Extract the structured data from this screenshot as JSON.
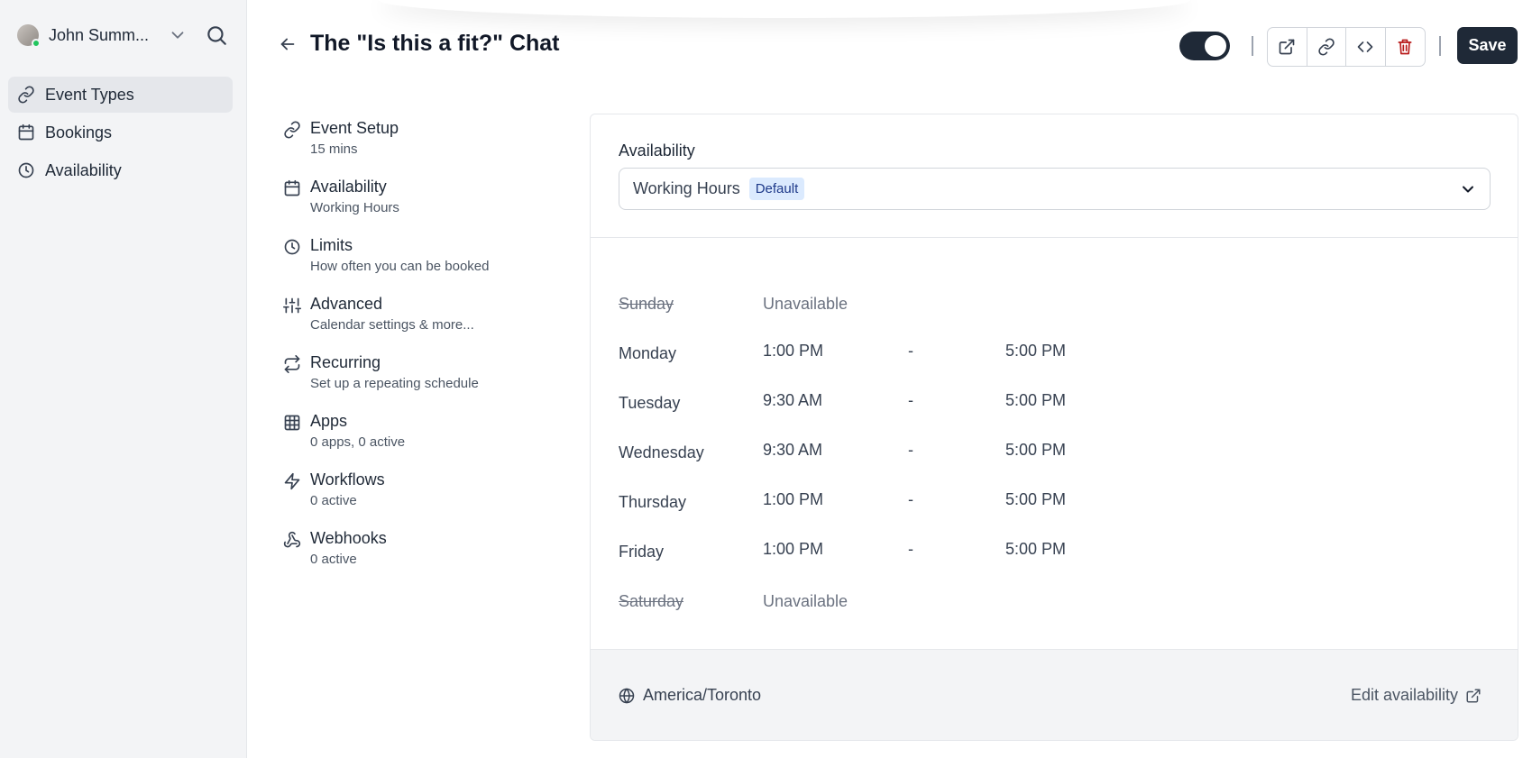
{
  "sidebar": {
    "user_name": "John Summ...",
    "items": [
      {
        "label": "Event Types",
        "icon": "link-icon"
      },
      {
        "label": "Bookings",
        "icon": "calendar-icon"
      },
      {
        "label": "Availability",
        "icon": "clock-icon"
      }
    ]
  },
  "header": {
    "title": "The \"Is this a fit?\" Chat",
    "save_label": "Save",
    "toggle_on": true
  },
  "tabs": [
    {
      "title": "Event Setup",
      "subtitle": "15 mins",
      "icon": "link-icon"
    },
    {
      "title": "Availability",
      "subtitle": "Working Hours",
      "icon": "calendar-icon"
    },
    {
      "title": "Limits",
      "subtitle": "How often you can be booked",
      "icon": "clock-icon"
    },
    {
      "title": "Advanced",
      "subtitle": "Calendar settings & more...",
      "icon": "sliders-icon"
    },
    {
      "title": "Recurring",
      "subtitle": "Set up a repeating schedule",
      "icon": "repeat-icon"
    },
    {
      "title": "Apps",
      "subtitle": "0 apps, 0 active",
      "icon": "grid-icon"
    },
    {
      "title": "Workflows",
      "subtitle": "0 active",
      "icon": "zap-icon"
    },
    {
      "title": "Webhooks",
      "subtitle": "0 active",
      "icon": "webhook-icon"
    }
  ],
  "availability": {
    "label": "Availability",
    "schedule": "Working Hours",
    "badge": "Default",
    "separator": "-",
    "unavailable_text": "Unavailable",
    "days": [
      {
        "name": "Sunday",
        "available": false
      },
      {
        "name": "Monday",
        "available": true,
        "start": "1:00 PM",
        "end": "5:00 PM"
      },
      {
        "name": "Tuesday",
        "available": true,
        "start": "9:30 AM",
        "end": "5:00 PM"
      },
      {
        "name": "Wednesday",
        "available": true,
        "start": "9:30 AM",
        "end": "5:00 PM"
      },
      {
        "name": "Thursday",
        "available": true,
        "start": "1:00 PM",
        "end": "5:00 PM"
      },
      {
        "name": "Friday",
        "available": true,
        "start": "1:00 PM",
        "end": "5:00 PM"
      },
      {
        "name": "Saturday",
        "available": false
      }
    ],
    "timezone": "America/Toronto",
    "edit_label": "Edit availability"
  },
  "colors": {
    "accent": "#1f2937",
    "badge_bg": "#dbeafe",
    "online": "#22c55e"
  }
}
